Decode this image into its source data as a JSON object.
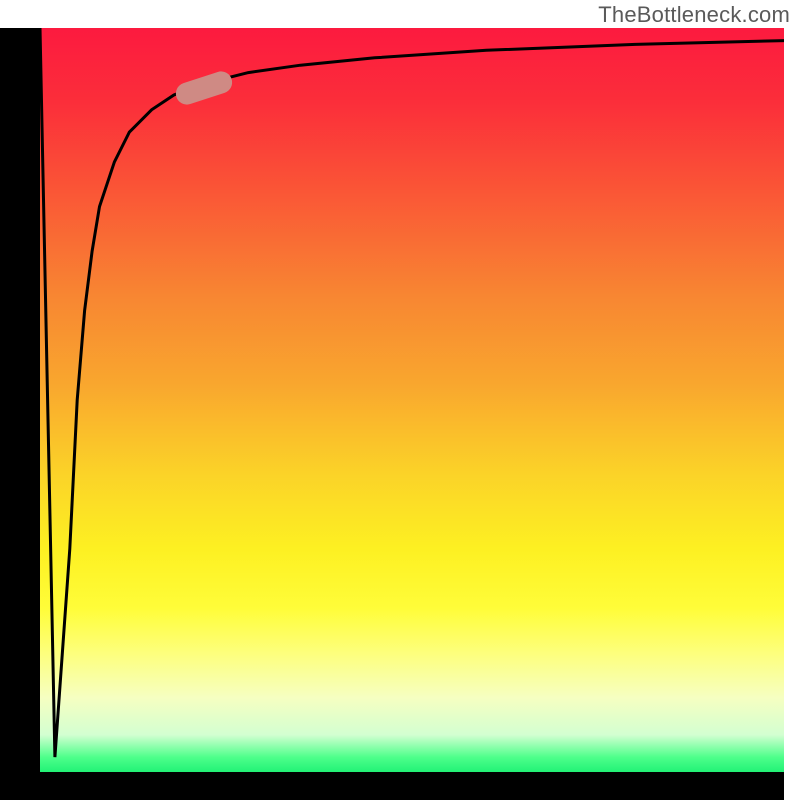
{
  "watermark": "TheBottleneck.com",
  "colors": {
    "axis": "#000000",
    "curve": "#000000",
    "marker": "#cf8a84",
    "watermark_text": "#5a5a5a"
  },
  "chart_data": {
    "type": "line",
    "title": "",
    "xlabel": "",
    "ylabel": "",
    "xlim": [
      0,
      100
    ],
    "ylim": [
      0,
      100
    ],
    "series": [
      {
        "name": "bottleneck-curve",
        "x": [
          0,
          2,
          4,
          5,
          6,
          7,
          8,
          10,
          12,
          15,
          18,
          22,
          28,
          35,
          45,
          60,
          80,
          100
        ],
        "y": [
          100,
          2,
          30,
          50,
          62,
          70,
          76,
          82,
          86,
          89,
          91,
          92.5,
          94,
          95,
          96,
          97,
          97.8,
          98.3
        ]
      }
    ],
    "highlight": {
      "x_range": [
        18,
        26
      ],
      "y_approx": 92,
      "angle_deg": -18
    },
    "background_gradient": {
      "top": "#fc1a3f",
      "mid": "#fbe526",
      "bottom": "#22f276"
    }
  }
}
